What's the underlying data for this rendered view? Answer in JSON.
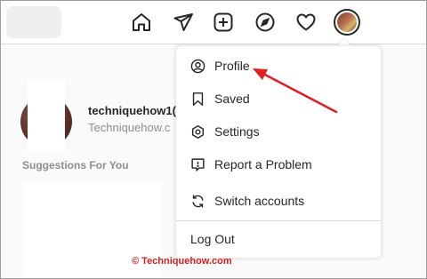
{
  "nav": {
    "icons": [
      "home-icon",
      "direct-message-icon",
      "new-post-icon",
      "explore-icon",
      "activity-heart-icon",
      "profile-avatar"
    ]
  },
  "profile": {
    "username": "techniquehow1(",
    "fullname": "Techniquehow.c"
  },
  "suggestions": {
    "title": "Suggestions For You"
  },
  "menu": {
    "items": [
      {
        "label": "Profile",
        "icon": "user-circle-icon"
      },
      {
        "label": "Saved",
        "icon": "bookmark-icon"
      },
      {
        "label": "Settings",
        "icon": "settings-gear-icon"
      },
      {
        "label": "Report a Problem",
        "icon": "report-problem-icon"
      },
      {
        "label": "Switch accounts",
        "icon": "switch-accounts-icon"
      }
    ],
    "logout": "Log Out"
  },
  "annotation": {
    "watermark": "© Techniquehow.com",
    "arrow_color": "#e0201f"
  }
}
